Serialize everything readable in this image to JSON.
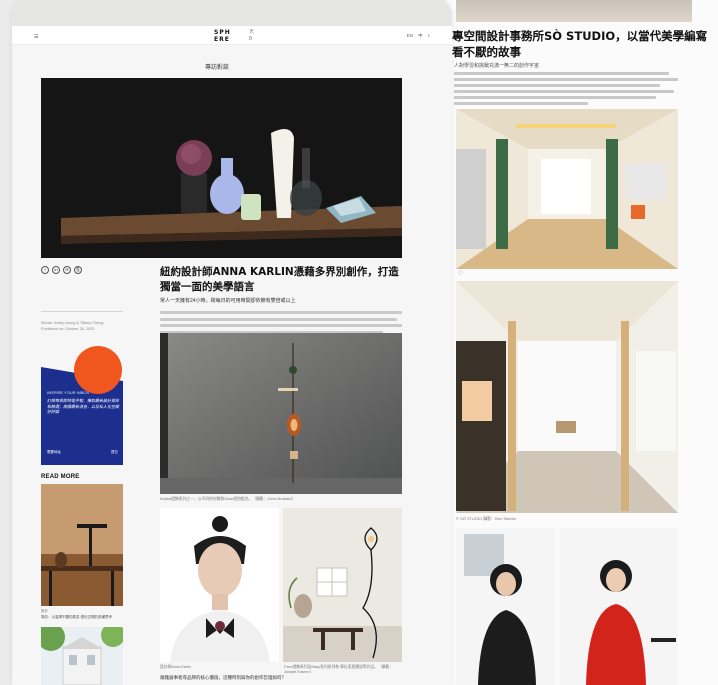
{
  "back_page": {
    "title": "專空間設計事務所SÒ STUDIO，以當代美學編寫看不厭的故事",
    "subtitle": "人對學習和挑戰充滿一無二的創作宇宙",
    "caption_1": "（ ）",
    "caption_2": "© SÒ STUDIO 攝影：Ben Stubbs"
  },
  "header": {
    "menu_icon": "hamburger-icon",
    "logo_line1": "SPH",
    "logo_line2": "ERE",
    "logo_side1": "天",
    "logo_side2": "B",
    "lang": "EN",
    "lang_alt": "中",
    "search_icon": "search-icon"
  },
  "article": {
    "section": "專訪對談",
    "title": "紐約設計師ANNA KARLIN憑藉多界別創作，打造獨當一面的美學語言",
    "subtitle": "常人一天擁有24小時，跨每日的可用時間卻依賴有雙倍或以上",
    "meta_1": "Words: Kathy Leung & Tiffany Cheng",
    "meta_2": "Published on: October 26, 2023",
    "caption_wall": "Kazilia燈飾系列之一，以不同的材質和Solar燈泡組合。（攝影：Chris Mottalini）",
    "caption_portrait": "設計師Anna Karlin",
    "caption_lamp": "Face燈飾系列及Baby系列系列和 單位家居擺設等作品。（攝影：Joseph Kramm）",
    "bottom_question": "跟雜論事者尋品牌的核心價值，這種時刻與你的創作哲理如何？"
  },
  "share": {
    "icons": [
      "facebook-icon",
      "linkedin-icon",
      "email-icon",
      "link-icon"
    ],
    "labels": [
      "f",
      "in",
      "✉",
      "⎘"
    ]
  },
  "newsletter": {
    "eyebrow": "INSPIRE YOUR INBOX",
    "body": "訂閱每周即時電子報，獲取最新設計資訊和精選；閱讀最新消息，以及私人化空間好評論",
    "subscribe_label": "電郵地址",
    "submit_label": "提交",
    "accent_orange": "#f0561e",
    "accent_blue": "#1c2f8f"
  },
  "read_more": {
    "heading": "READ MORE",
    "item1_category": "設計",
    "item1_title": "專訪：以溫潤不羈的氣息 優化空間的各種思考"
  },
  "colors": {
    "page_bg": "#f5f6f5",
    "header_bg": "#e6e6e5",
    "text": "#111111"
  }
}
